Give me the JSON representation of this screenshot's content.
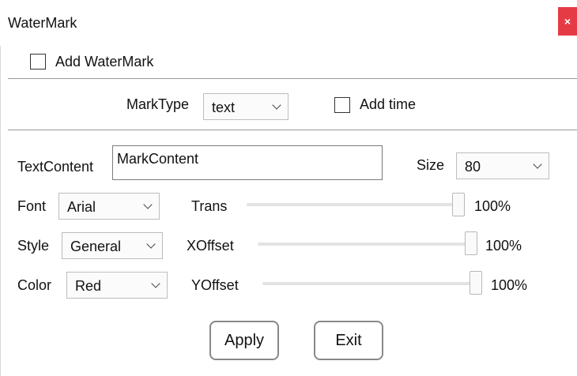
{
  "window": {
    "title": "WaterMark",
    "close_glyph": "×"
  },
  "add_watermark": {
    "label": "Add WaterMark",
    "checked": false
  },
  "mark_type": {
    "label": "MarkType",
    "value": "text"
  },
  "add_time": {
    "label": "Add time",
    "checked": false
  },
  "text_content": {
    "label": "TextContent",
    "value": "MarkContent"
  },
  "size": {
    "label": "Size",
    "value": "80"
  },
  "font": {
    "label": "Font",
    "value": "Arial"
  },
  "style": {
    "label": "Style",
    "value": "General"
  },
  "color": {
    "label": "Color",
    "value": "Red"
  },
  "trans": {
    "label": "Trans",
    "value": "100%",
    "fraction": 1.0
  },
  "xoffset": {
    "label": "XOffset",
    "value": "100%",
    "fraction": 1.0
  },
  "yoffset": {
    "label": "YOffset",
    "value": "100%",
    "fraction": 1.0
  },
  "buttons": {
    "apply": "Apply",
    "exit": "Exit"
  },
  "colors": {
    "close_bg": "#e53b45",
    "divider": "#9a9a9a"
  }
}
